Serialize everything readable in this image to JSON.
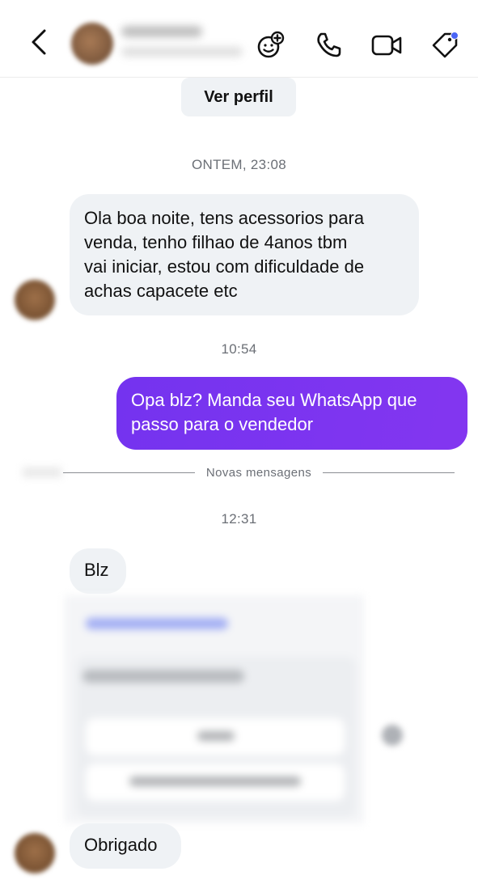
{
  "header": {
    "contact_name": "",
    "contact_subtitle": "",
    "icons": [
      "back-chevron-icon",
      "game-controller-icon",
      "phone-icon",
      "video-camera-icon",
      "tag-icon"
    ],
    "accent_dot_color": "#4a65f5"
  },
  "profile_button": {
    "label": "Ver perfil"
  },
  "messages": [
    {
      "type": "timestamp",
      "text": "ONTEM, 23:08"
    },
    {
      "type": "incoming",
      "lines": [
        "Ola boa noite, tens acessorios para",
        "venda, tenho filhao de 4anos tbm",
        "vai iniciar, estou com dificuldade de",
        "achas capacete etc"
      ]
    },
    {
      "type": "timestamp",
      "text": "10:54"
    },
    {
      "type": "outgoing",
      "lines": [
        "Opa blz? Manda seu WhatsApp que",
        "passo para o vendedor"
      ]
    },
    {
      "type": "divider",
      "text": "Novas mensagens"
    },
    {
      "type": "timestamp",
      "text": "12:31"
    },
    {
      "type": "incoming",
      "lines": [
        "Blz"
      ]
    },
    {
      "type": "incoming",
      "lines": [
        "Obrigado"
      ]
    }
  ],
  "colors": {
    "incoming_bubble": "#eff2f5",
    "outgoing_bubble": "#7a2ff0",
    "timestamp_text": "#6b6f76"
  }
}
